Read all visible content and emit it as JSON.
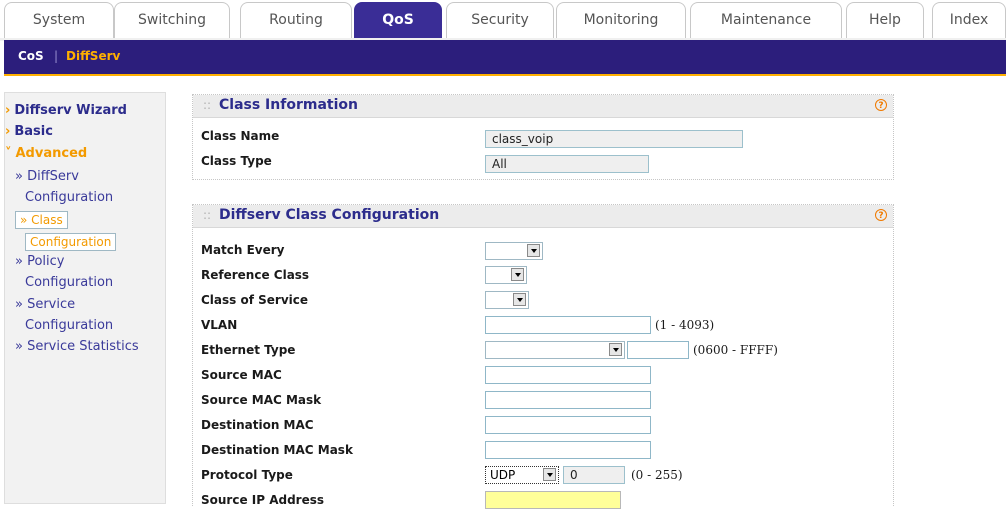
{
  "tabs": [
    "System",
    "Switching",
    "Routing",
    "QoS",
    "Security",
    "Monitoring",
    "Maintenance",
    "Help",
    "Index"
  ],
  "active_tab": "QoS",
  "subnav": {
    "cos": "CoS",
    "sep": "|",
    "diffserv": "DiffServ"
  },
  "leftnav": {
    "wizard": "Diffserv Wizard",
    "basic": "Basic",
    "advanced": "Advanced",
    "diffserv_a": "» DiffServ",
    "diffserv_b": "Configuration",
    "class_a": "» Class",
    "class_b": "Configuration",
    "policy_a": "» Policy",
    "policy_b": "Configuration",
    "service_a": "» Service",
    "service_b": "Configuration",
    "service_stats": "» Service Statistics",
    "mark_closed": "›",
    "mark_open": "˅"
  },
  "class_info": {
    "title": "Class Information",
    "help": "?",
    "class_name_label": "Class Name",
    "class_name_value": "class_voip",
    "class_type_label": "Class Type",
    "class_type_value": "All"
  },
  "class_config": {
    "title": "Diffserv Class Configuration",
    "help": "?",
    "match_every": "Match Every",
    "reference_class": "Reference Class",
    "class_of_service": "Class of Service",
    "vlan": "VLAN",
    "vlan_range": "(1 - 4093)",
    "ethernet_type": "Ethernet Type",
    "ethernet_range": "(0600 - FFFF)",
    "source_mac": "Source MAC",
    "source_mac_mask": "Source MAC Mask",
    "destination_mac": "Destination MAC",
    "destination_mac_mask": "Destination MAC Mask",
    "protocol_type": "Protocol Type",
    "protocol_value": "UDP",
    "protocol_number": "0",
    "protocol_range": "(0 - 255)",
    "source_ip": "Source IP Address"
  },
  "colors": {
    "accent": "#3a2d96",
    "nav_bg": "#2c1e7c",
    "orange": "#f39a00",
    "title": "#2c2c8c"
  }
}
